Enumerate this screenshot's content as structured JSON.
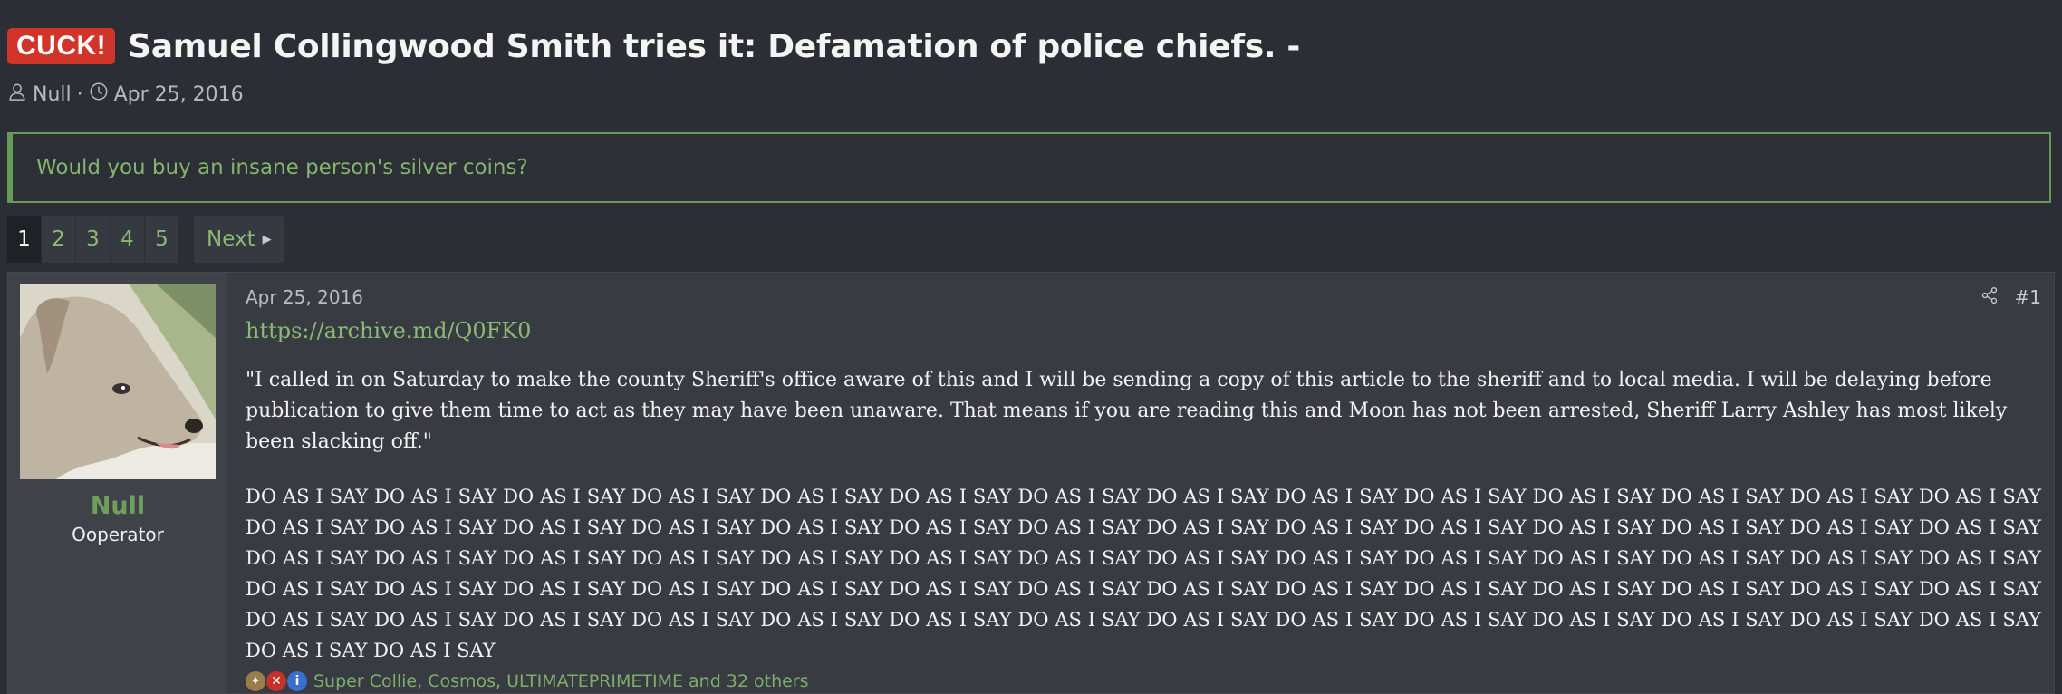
{
  "thread": {
    "prefix": "CUCK!",
    "title": "Samuel Collingwood Smith tries it: Defamation of police chiefs. -",
    "author": "Null",
    "separator": "·",
    "date": "Apr 25, 2016"
  },
  "notice": {
    "text": "Would you buy an insane person's silver coins?"
  },
  "pagination": {
    "pages": [
      "1",
      "2",
      "3",
      "4",
      "5"
    ],
    "current": "1",
    "next_label": "Next"
  },
  "post": {
    "username": "Null",
    "user_title": "Ooperator",
    "date": "Apr 25, 2016",
    "number": "#1",
    "link": "https://archive.md/Q0FK0",
    "quote": "\"I called in on Saturday to make the county Sheriff's office aware of this and I will be sending a copy of this article to the sheriff and to local media. I will be delaying before publication to give them time to act as they may have been unaware. That means if you are reading this and Moon has not been arrested, Sheriff Larry Ashley has most likely been slacking off.\"",
    "shout": "DO AS I SAY DO AS I SAY DO AS I SAY DO AS I SAY DO AS I SAY DO AS I SAY DO AS I SAY DO AS I SAY DO AS I SAY DO AS I SAY DO AS I SAY DO AS I SAY DO AS I SAY DO AS I SAY DO AS I SAY DO AS I SAY DO AS I SAY DO AS I SAY DO AS I SAY DO AS I SAY DO AS I SAY DO AS I SAY DO AS I SAY DO AS I SAY DO AS I SAY DO AS I SAY DO AS I SAY DO AS I SAY DO AS I SAY DO AS I SAY DO AS I SAY DO AS I SAY DO AS I SAY DO AS I SAY DO AS I SAY DO AS I SAY DO AS I SAY DO AS I SAY DO AS I SAY DO AS I SAY DO AS I SAY DO AS I SAY DO AS I SAY DO AS I SAY DO AS I SAY DO AS I SAY DO AS I SAY DO AS I SAY DO AS I SAY DO AS I SAY DO AS I SAY DO AS I SAY DO AS I SAY DO AS I SAY DO AS I SAY DO AS I SAY DO AS I SAY DO AS I SAY DO AS I SAY DO AS I SAY DO AS I SAY DO AS I SAY DO AS I SAY DO AS I SAY DO AS I SAY DO AS I SAY DO AS I SAY DO AS I SAY DO AS I SAY DO AS I SAY DO AS I SAY DO AS I SAY",
    "reactions_text": "Super Collie, Cosmos, ULTIMATEPRIMETIME and 32 others"
  },
  "icons": {
    "author": "user-icon",
    "date": "clock-icon",
    "share": "share-icon",
    "reactions": [
      "trophy-icon",
      "x-icon",
      "info-icon"
    ]
  },
  "colors": {
    "prefix_bg": "#d0342a",
    "accent_green": "#6a9a58",
    "link_green": "#8ab877",
    "background": "#2b2e34"
  }
}
